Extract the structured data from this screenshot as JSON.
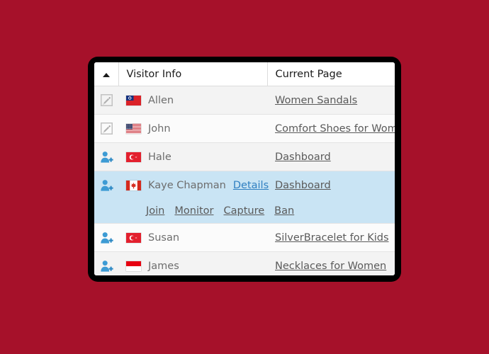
{
  "theme": {
    "background": "#a6112a",
    "frame": "#000000",
    "panel": "#ffffff",
    "selected_row": "#c9e4f4",
    "stripe_a": "#f3f3f3",
    "stripe_b": "#fbfbfb",
    "link": "#5a5a5a",
    "link_active": "#2f7fc1",
    "text": "#6d6d6d",
    "header_text": "#1b1b1b"
  },
  "table": {
    "sort_indicator": "sort-ascending-caret",
    "columns": [
      {
        "key": "icon",
        "label": ""
      },
      {
        "key": "visitor_info",
        "label": "Visitor Info"
      },
      {
        "key": "current_page",
        "label": "Current Page"
      }
    ],
    "rows": [
      {
        "icon": "edit-icon",
        "flag": "tw",
        "flag_label": "Taiwan",
        "name": "Allen",
        "page": "Women Sandals",
        "selected": false
      },
      {
        "icon": "edit-icon",
        "flag": "us",
        "flag_label": "United States",
        "name": "John",
        "page": "Comfort Shoes for Women",
        "selected": false
      },
      {
        "icon": "add-user-icon",
        "flag": "tr",
        "flag_label": "Turkey",
        "name": "Hale",
        "page": "Dashboard",
        "selected": false
      },
      {
        "icon": "add-user-icon",
        "flag": "ca",
        "flag_label": "Canada",
        "name": "Kaye Chapman",
        "details_label": "Details",
        "page": "Dashboard",
        "selected": true,
        "actions": [
          "Join",
          "Monitor",
          "Capture",
          "Ban"
        ]
      },
      {
        "icon": "add-user-icon",
        "flag": "tr",
        "flag_label": "Turkey",
        "name": "Susan",
        "page": "SilverBracelet for Kids",
        "selected": false
      },
      {
        "icon": "add-user-icon",
        "flag": "id",
        "flag_label": "Indonesia",
        "name": "James",
        "page": "Necklaces for Women",
        "selected": false
      }
    ]
  }
}
